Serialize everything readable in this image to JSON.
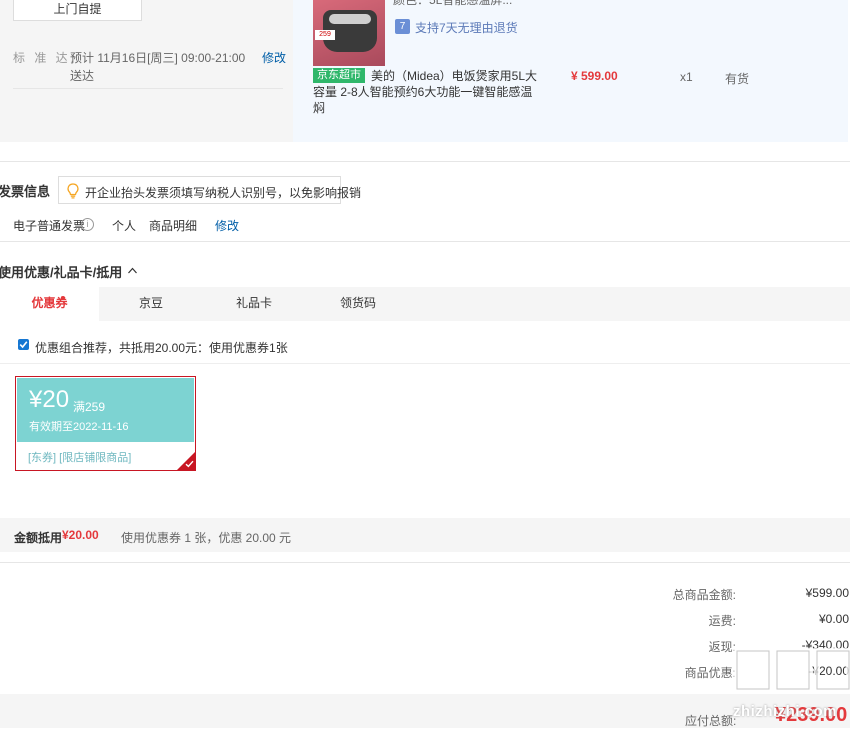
{
  "delivery": {
    "pickup_label": "上门自提",
    "standard_label": "标 准 达:",
    "standard_value": "预计 11月16日[周三] 09:00-21:00 送达",
    "edit_label": "修改"
  },
  "product": {
    "cut_text": "颜色：5L智能感温屏...",
    "return_policy": "支持7天无理由退货",
    "return_icon": "7",
    "store_tag": "京东超市",
    "name": "美的（Midea）电饭煲家用5L大容量 2-8人智能预约6大功能一键智能感温焖",
    "price": "¥ 599.00",
    "quantity": "x1",
    "stock": "有货",
    "thumb_tag": "259"
  },
  "invoice": {
    "title": "发票信息",
    "tip": "开企业抬头发票须填写纳税人识别号，以免影响报销",
    "type": "电子普通发票",
    "info_icon": "i",
    "person": "个人",
    "detail": "商品明细",
    "edit_label": "修改"
  },
  "coupons": {
    "title": "使用优惠/礼品卡/抵用",
    "tabs": [
      {
        "label": "优惠券"
      },
      {
        "label": "京豆"
      },
      {
        "label": "礼品卡"
      },
      {
        "label": "领货码"
      }
    ],
    "combo_text": "优惠组合推荐，共抵用20.00元：使用优惠券1张",
    "card": {
      "amount": "¥20",
      "condition": "满259",
      "validity": "有效期至2022-11-16",
      "tags": "[东券]  [限店铺限商品]"
    },
    "deduct_label": "金额抵用",
    "deduct_amount": "¥20.00",
    "deduct_desc": "使用优惠券 1 张，优惠 20.00 元"
  },
  "summary": {
    "rows": [
      {
        "label": "总商品金额:",
        "value": "¥599.00"
      },
      {
        "label": "运费:",
        "value": "¥0.00"
      },
      {
        "label": "返现:",
        "value": "-¥340.00"
      },
      {
        "label": "商品优惠:",
        "value": "-¥20.00"
      }
    ],
    "payable_label": "应付总额:",
    "payable_value": "¥239.00"
  },
  "watermark": {
    "url": "zhizhizhi.com"
  },
  "colors": {
    "accent_red": "#e4393c",
    "link_blue": "#005ea7",
    "coupon_teal": "#7dd3d2",
    "jd_green": "#2fb76b"
  }
}
